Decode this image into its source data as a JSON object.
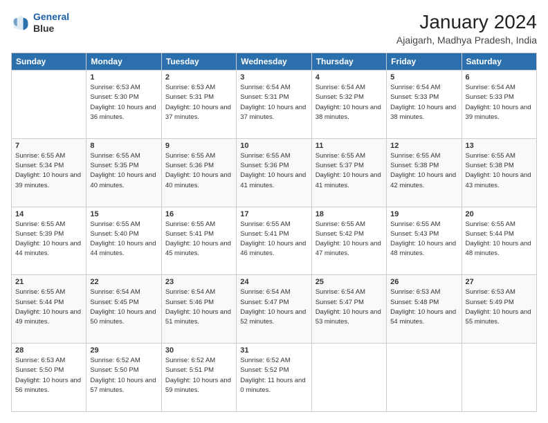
{
  "logo": {
    "line1": "General",
    "line2": "Blue"
  },
  "title": "January 2024",
  "location": "Ajaigarh, Madhya Pradesh, India",
  "headers": [
    "Sunday",
    "Monday",
    "Tuesday",
    "Wednesday",
    "Thursday",
    "Friday",
    "Saturday"
  ],
  "weeks": [
    [
      {
        "day": "",
        "sunrise": "",
        "sunset": "",
        "daylight": ""
      },
      {
        "day": "1",
        "sunrise": "Sunrise: 6:53 AM",
        "sunset": "Sunset: 5:30 PM",
        "daylight": "Daylight: 10 hours and 36 minutes."
      },
      {
        "day": "2",
        "sunrise": "Sunrise: 6:53 AM",
        "sunset": "Sunset: 5:31 PM",
        "daylight": "Daylight: 10 hours and 37 minutes."
      },
      {
        "day": "3",
        "sunrise": "Sunrise: 6:54 AM",
        "sunset": "Sunset: 5:31 PM",
        "daylight": "Daylight: 10 hours and 37 minutes."
      },
      {
        "day": "4",
        "sunrise": "Sunrise: 6:54 AM",
        "sunset": "Sunset: 5:32 PM",
        "daylight": "Daylight: 10 hours and 38 minutes."
      },
      {
        "day": "5",
        "sunrise": "Sunrise: 6:54 AM",
        "sunset": "Sunset: 5:33 PM",
        "daylight": "Daylight: 10 hours and 38 minutes."
      },
      {
        "day": "6",
        "sunrise": "Sunrise: 6:54 AM",
        "sunset": "Sunset: 5:33 PM",
        "daylight": "Daylight: 10 hours and 39 minutes."
      }
    ],
    [
      {
        "day": "7",
        "sunrise": "Sunrise: 6:55 AM",
        "sunset": "Sunset: 5:34 PM",
        "daylight": "Daylight: 10 hours and 39 minutes."
      },
      {
        "day": "8",
        "sunrise": "Sunrise: 6:55 AM",
        "sunset": "Sunset: 5:35 PM",
        "daylight": "Daylight: 10 hours and 40 minutes."
      },
      {
        "day": "9",
        "sunrise": "Sunrise: 6:55 AM",
        "sunset": "Sunset: 5:36 PM",
        "daylight": "Daylight: 10 hours and 40 minutes."
      },
      {
        "day": "10",
        "sunrise": "Sunrise: 6:55 AM",
        "sunset": "Sunset: 5:36 PM",
        "daylight": "Daylight: 10 hours and 41 minutes."
      },
      {
        "day": "11",
        "sunrise": "Sunrise: 6:55 AM",
        "sunset": "Sunset: 5:37 PM",
        "daylight": "Daylight: 10 hours and 41 minutes."
      },
      {
        "day": "12",
        "sunrise": "Sunrise: 6:55 AM",
        "sunset": "Sunset: 5:38 PM",
        "daylight": "Daylight: 10 hours and 42 minutes."
      },
      {
        "day": "13",
        "sunrise": "Sunrise: 6:55 AM",
        "sunset": "Sunset: 5:38 PM",
        "daylight": "Daylight: 10 hours and 43 minutes."
      }
    ],
    [
      {
        "day": "14",
        "sunrise": "Sunrise: 6:55 AM",
        "sunset": "Sunset: 5:39 PM",
        "daylight": "Daylight: 10 hours and 44 minutes."
      },
      {
        "day": "15",
        "sunrise": "Sunrise: 6:55 AM",
        "sunset": "Sunset: 5:40 PM",
        "daylight": "Daylight: 10 hours and 44 minutes."
      },
      {
        "day": "16",
        "sunrise": "Sunrise: 6:55 AM",
        "sunset": "Sunset: 5:41 PM",
        "daylight": "Daylight: 10 hours and 45 minutes."
      },
      {
        "day": "17",
        "sunrise": "Sunrise: 6:55 AM",
        "sunset": "Sunset: 5:41 PM",
        "daylight": "Daylight: 10 hours and 46 minutes."
      },
      {
        "day": "18",
        "sunrise": "Sunrise: 6:55 AM",
        "sunset": "Sunset: 5:42 PM",
        "daylight": "Daylight: 10 hours and 47 minutes."
      },
      {
        "day": "19",
        "sunrise": "Sunrise: 6:55 AM",
        "sunset": "Sunset: 5:43 PM",
        "daylight": "Daylight: 10 hours and 48 minutes."
      },
      {
        "day": "20",
        "sunrise": "Sunrise: 6:55 AM",
        "sunset": "Sunset: 5:44 PM",
        "daylight": "Daylight: 10 hours and 48 minutes."
      }
    ],
    [
      {
        "day": "21",
        "sunrise": "Sunrise: 6:55 AM",
        "sunset": "Sunset: 5:44 PM",
        "daylight": "Daylight: 10 hours and 49 minutes."
      },
      {
        "day": "22",
        "sunrise": "Sunrise: 6:54 AM",
        "sunset": "Sunset: 5:45 PM",
        "daylight": "Daylight: 10 hours and 50 minutes."
      },
      {
        "day": "23",
        "sunrise": "Sunrise: 6:54 AM",
        "sunset": "Sunset: 5:46 PM",
        "daylight": "Daylight: 10 hours and 51 minutes."
      },
      {
        "day": "24",
        "sunrise": "Sunrise: 6:54 AM",
        "sunset": "Sunset: 5:47 PM",
        "daylight": "Daylight: 10 hours and 52 minutes."
      },
      {
        "day": "25",
        "sunrise": "Sunrise: 6:54 AM",
        "sunset": "Sunset: 5:47 PM",
        "daylight": "Daylight: 10 hours and 53 minutes."
      },
      {
        "day": "26",
        "sunrise": "Sunrise: 6:53 AM",
        "sunset": "Sunset: 5:48 PM",
        "daylight": "Daylight: 10 hours and 54 minutes."
      },
      {
        "day": "27",
        "sunrise": "Sunrise: 6:53 AM",
        "sunset": "Sunset: 5:49 PM",
        "daylight": "Daylight: 10 hours and 55 minutes."
      }
    ],
    [
      {
        "day": "28",
        "sunrise": "Sunrise: 6:53 AM",
        "sunset": "Sunset: 5:50 PM",
        "daylight": "Daylight: 10 hours and 56 minutes."
      },
      {
        "day": "29",
        "sunrise": "Sunrise: 6:52 AM",
        "sunset": "Sunset: 5:50 PM",
        "daylight": "Daylight: 10 hours and 57 minutes."
      },
      {
        "day": "30",
        "sunrise": "Sunrise: 6:52 AM",
        "sunset": "Sunset: 5:51 PM",
        "daylight": "Daylight: 10 hours and 59 minutes."
      },
      {
        "day": "31",
        "sunrise": "Sunrise: 6:52 AM",
        "sunset": "Sunset: 5:52 PM",
        "daylight": "Daylight: 11 hours and 0 minutes."
      },
      {
        "day": "",
        "sunrise": "",
        "sunset": "",
        "daylight": ""
      },
      {
        "day": "",
        "sunrise": "",
        "sunset": "",
        "daylight": ""
      },
      {
        "day": "",
        "sunrise": "",
        "sunset": "",
        "daylight": ""
      }
    ]
  ]
}
